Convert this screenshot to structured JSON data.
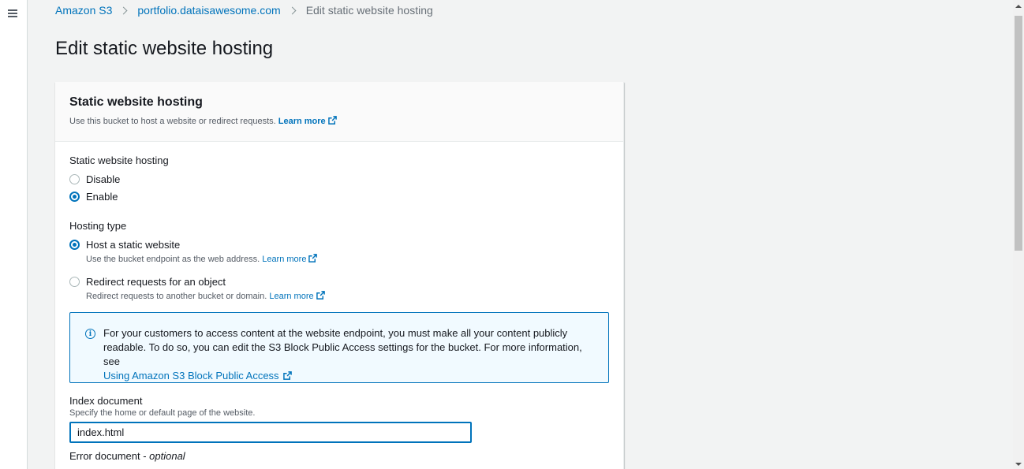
{
  "breadcrumb": {
    "root": "Amazon S3",
    "bucket": "portfolio.dataisawesome.com",
    "current": "Edit static website hosting"
  },
  "page": {
    "title": "Edit static website hosting"
  },
  "container": {
    "title": "Static website hosting",
    "description": "Use this bucket to host a website or redirect requests.",
    "learn_more": "Learn more"
  },
  "hosting": {
    "label": "Static website hosting",
    "options": [
      {
        "label": "Disable",
        "checked": false
      },
      {
        "label": "Enable",
        "checked": true
      }
    ]
  },
  "hosting_type": {
    "label": "Hosting type",
    "options": [
      {
        "label": "Host a static website",
        "description": "Use the bucket endpoint as the web address.",
        "learn_more": "Learn more",
        "checked": true
      },
      {
        "label": "Redirect requests for an object",
        "description": "Redirect requests to another bucket or domain.",
        "learn_more": "Learn more",
        "checked": false
      }
    ]
  },
  "info": {
    "text": "For your customers to access content at the website endpoint, you must make all your content publicly readable. To do so, you can edit the S3 Block Public Access settings for the bucket. For more information, see",
    "link": "Using Amazon S3 Block Public Access"
  },
  "index_document": {
    "label": "Index document",
    "description": "Specify the home or default page of the website.",
    "value": "index.html"
  },
  "error_document": {
    "label": "Error document",
    "optional": "optional",
    "separator": " - "
  },
  "colors": {
    "accent": "#0073bb",
    "background": "#f2f3f3",
    "info_background": "#f1faff"
  }
}
